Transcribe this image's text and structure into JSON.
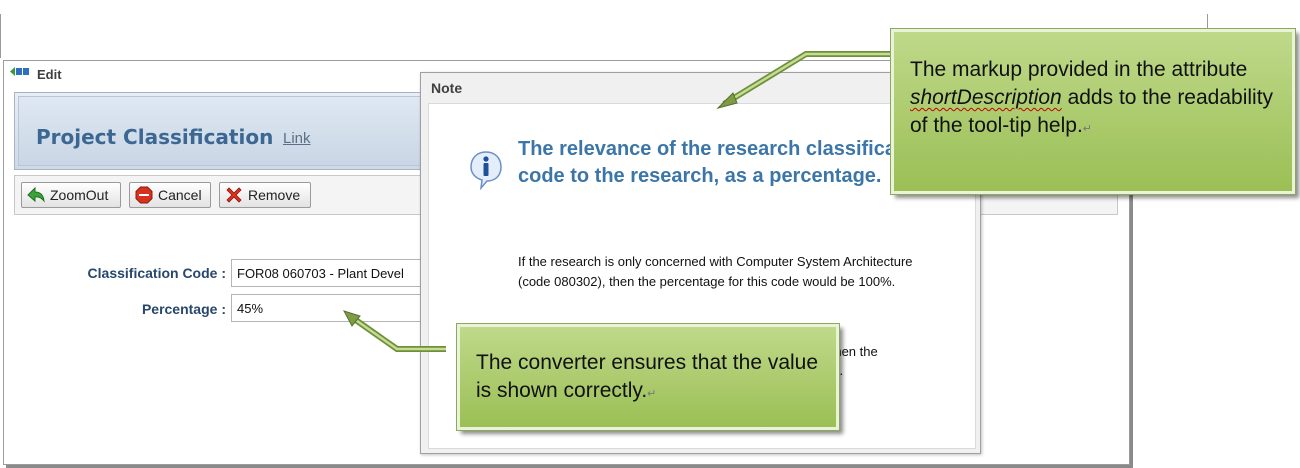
{
  "edit_window": {
    "title": "Edit",
    "page_title": "Project Classification",
    "link_label": "Link",
    "toolbar": {
      "zoomout_label": "ZoomOut",
      "cancel_label": "Cancel",
      "remove_label": "Remove"
    },
    "form": {
      "classification_code_label": "Classification Code :",
      "classification_code_value": "FOR08 060703 - Plant Devel",
      "percentage_label": "Percentage :",
      "percentage_value": "45%"
    }
  },
  "note_dialog": {
    "title": "Note",
    "heading": "The relevance of the research classification code to the research, as a percentage.",
    "paragraph1": "If the research is only concerned with Computer System Architecture (code 080302), then the percentage for this code would be 100%.",
    "paragraph2": "s, then the",
    "paragraph2b": "on."
  },
  "callouts": {
    "top_text_1": "The markup provided in the attribute ",
    "top_text_italic": "shortDescription",
    "top_text_2": " adds to the readability of the tool-tip help.",
    "bottom_text": "The converter ensures that the value is shown correctly.",
    "return_mark": "↵"
  },
  "colors": {
    "callout_fill": "#a9c96a",
    "title_blue": "#3b6792",
    "heading_blue": "#3c76a8"
  }
}
